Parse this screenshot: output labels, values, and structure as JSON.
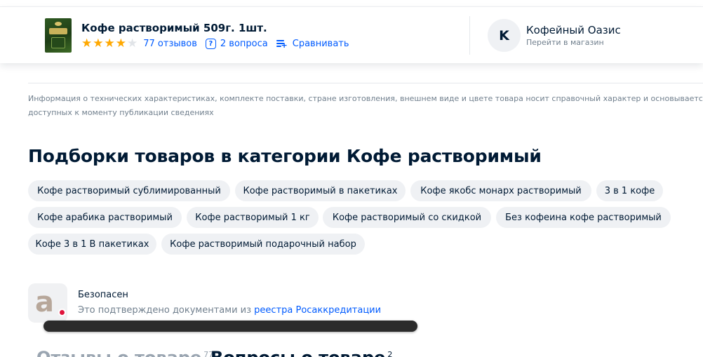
{
  "product": {
    "title": "Кофе растворимый 509г. 1шт.",
    "rating_stars": 4,
    "reviews_link": "77 отзывов",
    "questions_link": "2 вопроса",
    "compare_link": "Сравнивать"
  },
  "shop": {
    "avatar_letter": "K",
    "name": "Кофейный Оазис",
    "subtitle": "Перейти в магазин"
  },
  "disclaimer": {
    "line1": "Информация о технических характеристиках, комплекте поставки, стране изготовления, внешнем виде и цвете товара носит справочный характер и основывается на последних",
    "line2": "доступных к моменту публикации сведениях"
  },
  "collections": {
    "heading": "Подборки товаров в категории Кофе растворимый",
    "chips": [
      "Кофе растворимый сублимированный",
      "Кофе растворимый в пакетиках",
      "Кофе якобс монарх растворимый",
      "3 в 1 кофе",
      "Кофе арабика растворимый",
      "Кофе растворимый 1 кг",
      "Кофе растворимый со скидкой",
      "Без кофеина кофе растворимый",
      "Кофе 3 в 1 В пакетиках",
      "Кофе растворимый подарочный набор"
    ]
  },
  "safety": {
    "title": "Безопасен",
    "text": "Это подтверждено документами из ",
    "link": "реестра Росаккредитации"
  },
  "tabs": {
    "reviews_label": "Отзывы о товаре",
    "reviews_count": "77",
    "questions_label": "Вопросы о товаре",
    "questions_count": "2"
  },
  "colors": {
    "accent": "#005bff",
    "star": "#ffa800",
    "chip_bg": "#eff1f4",
    "text_primary": "#001a34",
    "text_secondary": "#707f8d",
    "badge_red": "#e0143c"
  }
}
